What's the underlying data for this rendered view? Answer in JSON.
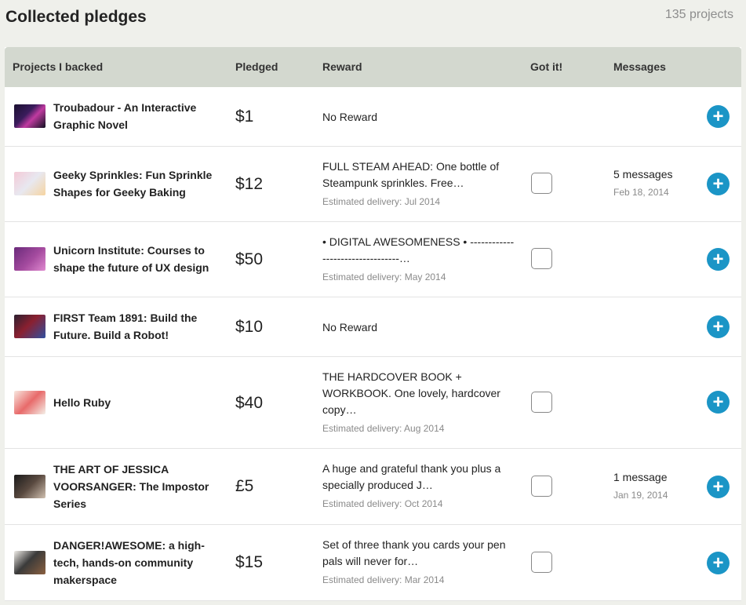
{
  "header": {
    "title": "Collected pledges",
    "count": "135 projects"
  },
  "table": {
    "columns": [
      "Projects I backed",
      "Pledged",
      "Reward",
      "Got it!",
      "Messages"
    ],
    "rows": [
      {
        "name": "Troubadour - An Interactive Graphic Novel",
        "amount": "$1",
        "reward": "No Reward",
        "delivery": "",
        "has_checkbox": false,
        "messages": "",
        "msg_date": ""
      },
      {
        "name": "Geeky Sprinkles: Fun Sprinkle Shapes for Geeky Baking",
        "amount": "$12",
        "reward": "FULL STEAM AHEAD: One bottle of Steampunk sprinkles. Free…",
        "delivery": "Estimated delivery: Jul 2014",
        "has_checkbox": true,
        "messages": "5 messages",
        "msg_date": "Feb 18, 2014"
      },
      {
        "name": "Unicorn Institute: Courses to shape the future of UX design",
        "amount": "$50",
        "reward": "• DIGITAL AWESOMENESS • ---------------------------------…",
        "delivery": "Estimated delivery: May 2014",
        "has_checkbox": true,
        "messages": "",
        "msg_date": ""
      },
      {
        "name": "FIRST Team 1891: Build the Future. Build a Robot!",
        "amount": "$10",
        "reward": "No Reward",
        "delivery": "",
        "has_checkbox": false,
        "messages": "",
        "msg_date": ""
      },
      {
        "name": "Hello Ruby",
        "amount": "$40",
        "reward": "THE HARDCOVER BOOK + WORKBOOK. One lovely, hardcover copy…",
        "delivery": "Estimated delivery: Aug 2014",
        "has_checkbox": true,
        "messages": "",
        "msg_date": ""
      },
      {
        "name": "THE ART OF JESSICA VOORSANGER: The Impostor Series",
        "amount": "£5",
        "reward": "A huge and grateful thank you plus a specially produced J…",
        "delivery": "Estimated delivery: Oct 2014",
        "has_checkbox": true,
        "messages": "1 message",
        "msg_date": "Jan 19, 2014"
      },
      {
        "name": "DANGER!AWESOME: a high-tech, hands-on community makerspace",
        "amount": "$15",
        "reward": "Set of three thank you cards your pen pals will never for…",
        "delivery": "Estimated delivery: Mar 2014",
        "has_checkbox": true,
        "messages": "",
        "msg_date": ""
      }
    ]
  },
  "icons": {
    "add": "plus-circle-icon",
    "checkbox": "checkbox-empty"
  },
  "colors": {
    "accent": "#1b95c6",
    "header_bg": "#d3d8cf",
    "page_bg": "#eff0eb"
  }
}
